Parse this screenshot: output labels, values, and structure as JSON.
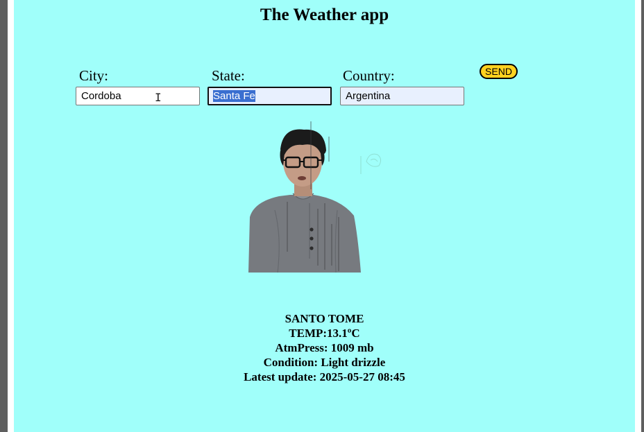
{
  "app": {
    "title": "The Weather app",
    "background": "#a0fffa"
  },
  "form": {
    "city": {
      "label": "City:",
      "value": "Cordoba"
    },
    "state": {
      "label": "State:",
      "value": "Santa Fe"
    },
    "country": {
      "label": "Country:",
      "value": "Argentina"
    },
    "send_label": "SEND",
    "send_color": "#ffd21f"
  },
  "weather": {
    "location": "SANTO TOME",
    "temp": "TEMP:13.1ºC",
    "pressure": "AtmPress: 1009 mb",
    "condition": "Condition: Light drizzle",
    "updated": "Latest update: 2025-05-27 08:45"
  }
}
